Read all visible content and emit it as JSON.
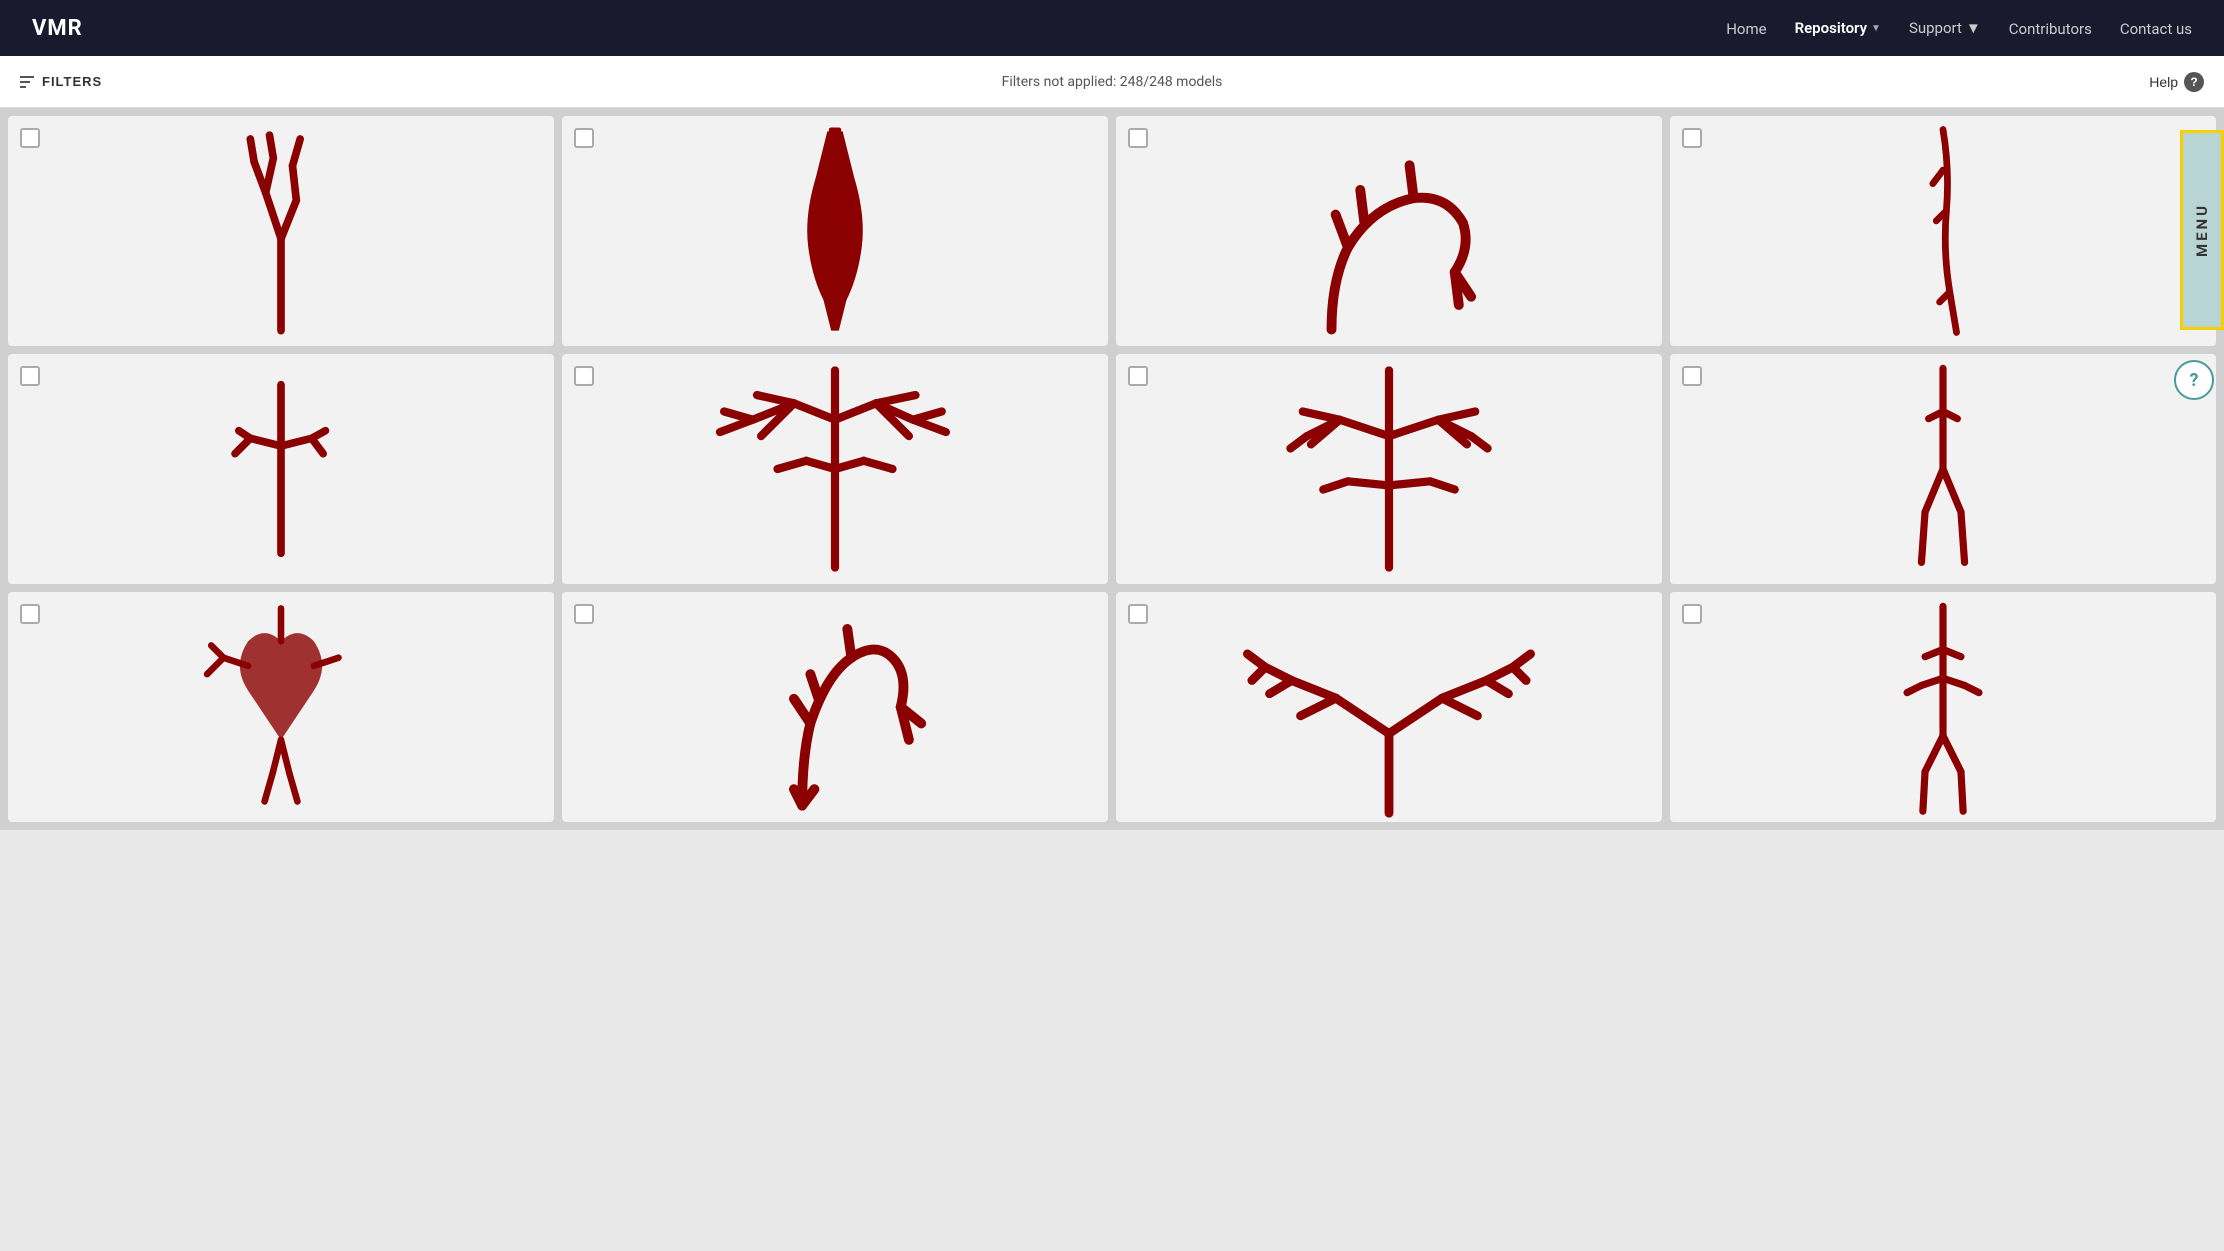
{
  "brand": "VMR",
  "nav": {
    "home": "Home",
    "repository": "Repository",
    "support": "Support",
    "contributors": "Contributors",
    "contact": "Contact us"
  },
  "filterBar": {
    "filtersLabel": "FILTERS",
    "statusText": "Filters not applied: 248/248 models",
    "helpLabel": "Help"
  },
  "menuTab": {
    "label": "MENU"
  },
  "models": [
    {
      "id": 1
    },
    {
      "id": 2
    },
    {
      "id": 3
    },
    {
      "id": 4
    },
    {
      "id": 5
    },
    {
      "id": 6
    },
    {
      "id": 7
    },
    {
      "id": 8
    },
    {
      "id": 9
    },
    {
      "id": 10
    },
    {
      "id": 11
    },
    {
      "id": 12
    }
  ]
}
